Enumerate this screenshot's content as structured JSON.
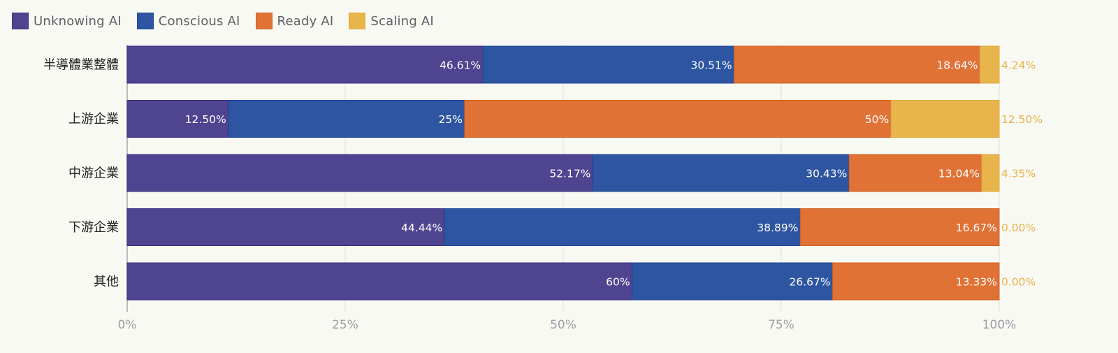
{
  "chart_data": {
    "type": "bar",
    "orientation": "horizontal",
    "stacked": true,
    "title": "",
    "xlabel": "",
    "ylabel": "",
    "xlim": [
      0,
      100
    ],
    "x_ticks": [
      "0%",
      "25%",
      "50%",
      "75%",
      "100%"
    ],
    "x_tick_values": [
      0,
      25,
      50,
      75,
      100
    ],
    "grid": true,
    "legend_position": "top-left",
    "categories": [
      "半導體業整體",
      "上游企業",
      "中游企業",
      "下游企業",
      "其他"
    ],
    "series": [
      {
        "name": "Unknowing AI",
        "color": "#4f4490",
        "values": [
          46.61,
          12.5,
          52.17,
          44.44,
          60
        ],
        "labels": [
          "46.61%",
          "12.50%",
          "52.17%",
          "44.44%",
          "60%"
        ],
        "bar_share": [
          40.8,
          11.6,
          53.4,
          36.4,
          57.9
        ]
      },
      {
        "name": "Conscious AI",
        "color": "#2e55a1",
        "values": [
          30.51,
          25,
          30.43,
          38.89,
          26.67
        ],
        "labels": [
          "30.51%",
          "25%",
          "30.43%",
          "38.89%",
          "26.67%"
        ],
        "bar_share": [
          28.8,
          27.1,
          29.4,
          40.8,
          23.0
        ]
      },
      {
        "name": "Ready AI",
        "color": "#e07236",
        "values": [
          18.64,
          50,
          13.04,
          16.67,
          13.33
        ],
        "labels": [
          "18.64%",
          "50%",
          "13.04%",
          "16.67%",
          "13.33%"
        ],
        "bar_share": [
          28.2,
          48.9,
          15.2,
          22.8,
          19.1
        ]
      },
      {
        "name": "Scaling AI",
        "color": "#e8b44c",
        "values": [
          4.24,
          12.5,
          4.35,
          0.0,
          0.0
        ],
        "labels": [
          "4.24%",
          "12.50%",
          "4.35%",
          "0.00%",
          "0.00%"
        ],
        "bar_share": [
          2.2,
          12.4,
          2.0,
          0,
          0
        ]
      }
    ]
  }
}
